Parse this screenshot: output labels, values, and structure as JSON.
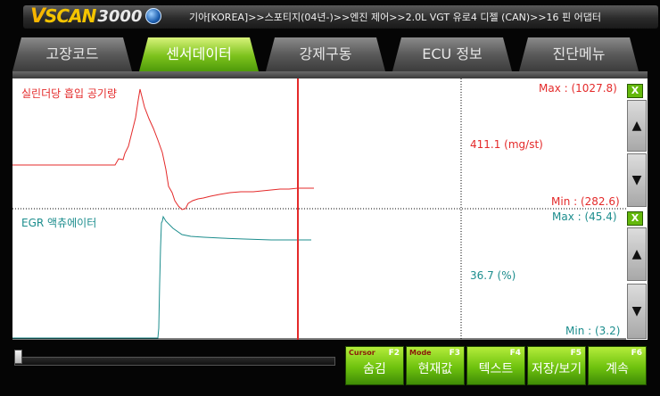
{
  "app": {
    "logo_v": "V",
    "logo_scan": "SCAN",
    "logo_num": "3000",
    "breadcrumb": "기아[KOREA]>>스포티지(04년-)>>엔진 제어>>2.0L VGT 유로4 디젤 (CAN)>>16 핀 어댑터"
  },
  "tabs": [
    {
      "label": "고장코드",
      "active": false
    },
    {
      "label": "센서데이터",
      "active": true
    },
    {
      "label": "강제구동",
      "active": false
    },
    {
      "label": "ECU 정보",
      "active": false
    },
    {
      "label": "진단메뉴",
      "active": false
    }
  ],
  "graphs": [
    {
      "title": "실린더당 흡입 공기량",
      "max": "Max : (1027.8)",
      "min": "Min : (282.6)",
      "current": "411.1 (mg/st)",
      "color": "#e42a2a",
      "close_label": "X",
      "up_label": "▲",
      "down_label": "▼"
    },
    {
      "title": "EGR 액츄에이터",
      "max": "Max : (45.4)",
      "min": "Min : (3.2)",
      "current": "36.7 (%)",
      "color": "#1c8d8d",
      "close_label": "X",
      "up_label": "▲",
      "down_label": "▼"
    }
  ],
  "colors": {
    "accent_green": "#6ec20e",
    "cursor_red": "#e42a2a",
    "teal": "#1c8d8d"
  },
  "function_buttons": [
    {
      "sub": "Cursor",
      "label": "숨김",
      "key": "F2"
    },
    {
      "sub": "Mode",
      "label": "현재값",
      "key": "F3"
    },
    {
      "sub": "",
      "label": "텍스트",
      "key": "F4"
    },
    {
      "sub": "",
      "label": "저장/보기",
      "key": "F5"
    },
    {
      "sub": "",
      "label": "계속",
      "key": "F6"
    }
  ]
}
